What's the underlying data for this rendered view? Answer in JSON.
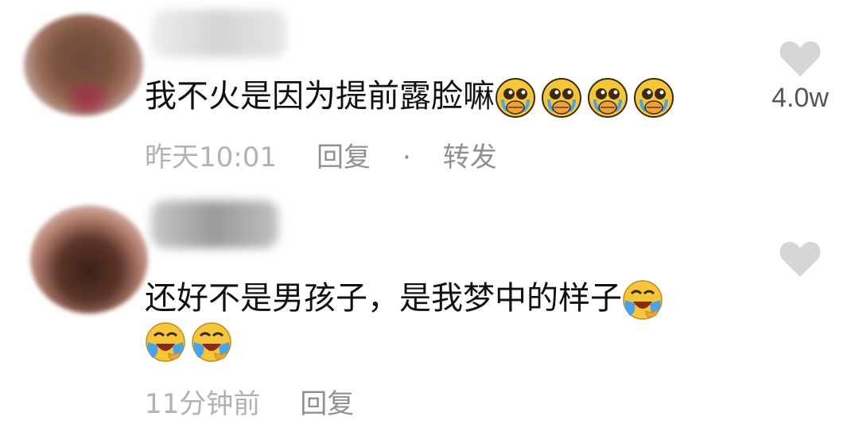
{
  "comments": [
    {
      "text": "我不火是因为提前露脸嘛",
      "emojis_inline": [
        "pleading-crying-icon",
        "pleading-crying-icon",
        "pleading-crying-icon",
        "pleading-crying-icon"
      ],
      "timestamp": "昨天10:01",
      "reply_label": "回复",
      "separator": "·",
      "forward_label": "转发",
      "like_count": "4.0w"
    },
    {
      "text": "还好不是男孩子，是我梦中的样子",
      "emojis_inline": [
        "laugh-crying-icon"
      ],
      "emojis_next_line": [
        "laugh-crying-icon",
        "laugh-crying-icon"
      ],
      "timestamp": "11分钟前",
      "reply_label": "回复",
      "like_count": ""
    }
  ],
  "colors": {
    "text": "#111111",
    "meta": "#b2b2b2",
    "heart": "#d6d6d6",
    "emoji_face": "#f6c63a"
  }
}
